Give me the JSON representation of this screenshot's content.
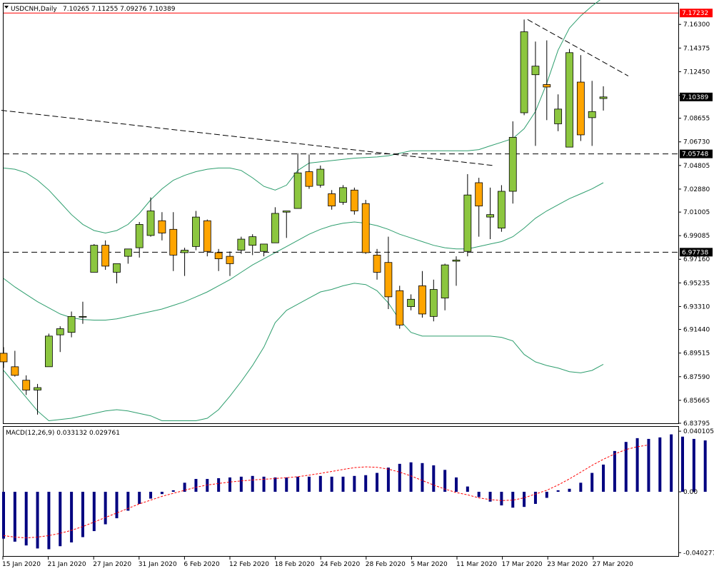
{
  "header": {
    "symbol_label": "USDCNH,Daily",
    "ohlc_label": "7.10265 7.11255 7.09276 7.10389"
  },
  "macd": {
    "label": "MACD(12,26,9) 0.033132 0.029761"
  },
  "colors": {
    "bull": "#8cc63f",
    "bear": "#ffa500",
    "candle_outline": "#000000",
    "bands": "#2e9e6e",
    "macd_hist": "#000080",
    "macd_signal": "#ff0000",
    "red_level": "#ff0000"
  },
  "chart_data": [
    {
      "type": "candlestick",
      "ylim": [
        6.83795,
        7.18
      ],
      "yticks": [
        "7.16300",
        "7.14375",
        "7.12450",
        "7.10525",
        "7.08655",
        "7.06730",
        "7.04805",
        "7.02880",
        "7.01005",
        "6.99085",
        "6.97160",
        "6.95235",
        "6.93310",
        "6.91440",
        "6.89515",
        "6.87590",
        "6.85665",
        "6.83795"
      ],
      "price_labels": [
        {
          "text": "7.17232",
          "value": 7.17232,
          "style": "red"
        },
        {
          "text": "7.10389",
          "value": 7.10389,
          "style": "box"
        },
        {
          "text": "7.05748",
          "value": 7.05748,
          "style": "box"
        },
        {
          "text": "6.97738",
          "value": 6.97738,
          "style": "box"
        }
      ],
      "x_labels": [
        "15 Jan 2020",
        "21 Jan 2020",
        "27 Jan 2020",
        "31 Jan 2020",
        "6 Feb 2020",
        "12 Feb 2020",
        "18 Feb 2020",
        "24 Feb 2020",
        "28 Feb 2020",
        "5 Mar 2020",
        "11 Mar 2020",
        "17 Mar 2020",
        "23 Mar 2020",
        "27 Mar 2020"
      ],
      "candles": [
        {
          "o": 6.895,
          "h": 6.9,
          "l": 6.883,
          "c": 6.888
        },
        {
          "o": 6.884,
          "h": 6.897,
          "l": 6.876,
          "c": 6.877
        },
        {
          "o": 6.873,
          "h": 6.877,
          "l": 6.861,
          "c": 6.865
        },
        {
          "o": 6.865,
          "h": 6.87,
          "l": 6.845,
          "c": 6.867
        },
        {
          "o": 6.884,
          "h": 6.911,
          "l": 6.884,
          "c": 6.909
        },
        {
          "o": 6.91,
          "h": 6.917,
          "l": 6.896,
          "c": 6.915
        },
        {
          "o": 6.912,
          "h": 6.929,
          "l": 6.908,
          "c": 6.925
        },
        {
          "o": 6.925,
          "h": 6.937,
          "l": 6.919,
          "c": 6.925
        },
        {
          "o": 6.961,
          "h": 6.984,
          "l": 6.961,
          "c": 6.983
        },
        {
          "o": 6.983,
          "h": 6.987,
          "l": 6.963,
          "c": 6.966
        },
        {
          "o": 6.961,
          "h": 6.968,
          "l": 6.952,
          "c": 6.968
        },
        {
          "o": 6.974,
          "h": 6.98,
          "l": 6.968,
          "c": 6.98
        },
        {
          "o": 6.981,
          "h": 7.002,
          "l": 6.973,
          "c": 7.0
        },
        {
          "o": 6.991,
          "h": 7.022,
          "l": 6.99,
          "c": 7.011
        },
        {
          "o": 7.003,
          "h": 7.01,
          "l": 6.987,
          "c": 6.993
        },
        {
          "o": 6.996,
          "h": 7.01,
          "l": 6.962,
          "c": 6.975
        },
        {
          "o": 6.977,
          "h": 6.981,
          "l": 6.958,
          "c": 6.979
        },
        {
          "o": 6.982,
          "h": 7.011,
          "l": 6.979,
          "c": 7.006
        },
        {
          "o": 7.003,
          "h": 7.004,
          "l": 6.974,
          "c": 6.978
        },
        {
          "o": 6.977,
          "h": 6.98,
          "l": 6.962,
          "c": 6.972
        },
        {
          "o": 6.974,
          "h": 6.978,
          "l": 6.958,
          "c": 6.968
        },
        {
          "o": 6.979,
          "h": 6.99,
          "l": 6.976,
          "c": 6.988
        },
        {
          "o": 6.983,
          "h": 6.992,
          "l": 6.975,
          "c": 6.99
        },
        {
          "o": 6.978,
          "h": 6.984,
          "l": 6.974,
          "c": 6.984
        },
        {
          "o": 6.985,
          "h": 7.014,
          "l": 6.985,
          "c": 7.009
        },
        {
          "o": 7.01,
          "h": 7.011,
          "l": 6.989,
          "c": 7.011
        },
        {
          "o": 7.013,
          "h": 7.058,
          "l": 7.013,
          "c": 7.042
        },
        {
          "o": 7.043,
          "h": 7.057,
          "l": 7.029,
          "c": 7.031
        },
        {
          "o": 7.032,
          "h": 7.048,
          "l": 7.03,
          "c": 7.045
        },
        {
          "o": 7.025,
          "h": 7.028,
          "l": 7.012,
          "c": 7.015
        },
        {
          "o": 7.018,
          "h": 7.032,
          "l": 7.016,
          "c": 7.03
        },
        {
          "o": 7.028,
          "h": 7.03,
          "l": 7.008,
          "c": 7.011
        },
        {
          "o": 7.017,
          "h": 7.02,
          "l": 6.976,
          "c": 6.977
        },
        {
          "o": 6.975,
          "h": 6.98,
          "l": 6.955,
          "c": 6.961
        },
        {
          "o": 6.969,
          "h": 6.99,
          "l": 6.931,
          "c": 6.941
        },
        {
          "o": 6.946,
          "h": 6.95,
          "l": 6.915,
          "c": 6.918
        },
        {
          "o": 6.933,
          "h": 6.943,
          "l": 6.93,
          "c": 6.939
        },
        {
          "o": 6.95,
          "h": 6.962,
          "l": 6.924,
          "c": 6.927
        },
        {
          "o": 6.925,
          "h": 6.955,
          "l": 6.921,
          "c": 6.947
        },
        {
          "o": 6.94,
          "h": 6.968,
          "l": 6.93,
          "c": 6.967
        },
        {
          "o": 6.97,
          "h": 6.974,
          "l": 6.95,
          "c": 6.971
        },
        {
          "o": 6.978,
          "h": 7.041,
          "l": 6.974,
          "c": 7.024
        },
        {
          "o": 7.034,
          "h": 7.038,
          "l": 6.99,
          "c": 7.015
        },
        {
          "o": 7.006,
          "h": 7.03,
          "l": 6.988,
          "c": 7.008
        },
        {
          "o": 6.997,
          "h": 7.032,
          "l": 6.994,
          "c": 7.027
        },
        {
          "o": 7.027,
          "h": 7.084,
          "l": 7.017,
          "c": 7.071
        },
        {
          "o": 7.091,
          "h": 7.167,
          "l": 7.089,
          "c": 7.157
        },
        {
          "o": 7.122,
          "h": 7.149,
          "l": 7.064,
          "c": 7.129
        },
        {
          "o": 7.114,
          "h": 7.15,
          "l": 7.085,
          "c": 7.112
        },
        {
          "o": 7.082,
          "h": 7.106,
          "l": 7.076,
          "c": 7.094
        },
        {
          "o": 7.063,
          "h": 7.143,
          "l": 7.063,
          "c": 7.14
        },
        {
          "o": 7.116,
          "h": 7.138,
          "l": 7.068,
          "c": 7.073
        },
        {
          "o": 7.087,
          "h": 7.117,
          "l": 7.064,
          "c": 7.092
        },
        {
          "o": 7.1026,
          "h": 7.1126,
          "l": 7.0928,
          "c": 7.1039
        }
      ],
      "bollinger": {
        "middle": [
          6.956,
          6.949,
          6.943,
          6.937,
          6.932,
          6.927,
          6.924,
          6.9225,
          6.922,
          6.922,
          6.923,
          6.925,
          6.927,
          6.929,
          6.931,
          6.934,
          6.937,
          6.941,
          6.945,
          6.95,
          6.955,
          6.961,
          6.967,
          6.972,
          6.977,
          6.982,
          6.987,
          6.992,
          6.996,
          6.999,
          7.001,
          7.002,
          7.001,
          6.999,
          6.996,
          6.992,
          6.989,
          6.986,
          6.983,
          6.981,
          6.98,
          6.98,
          6.982,
          6.984,
          6.986,
          6.99,
          6.997,
          7.005,
          7.011,
          7.016,
          7.021,
          7.025,
          7.029,
          7.034
        ],
        "upper": [
          7.046,
          7.045,
          7.042,
          7.036,
          7.028,
          7.018,
          7.008,
          7.0,
          6.995,
          6.993,
          6.995,
          7.0,
          7.009,
          7.02,
          7.029,
          7.036,
          7.04,
          7.043,
          7.045,
          7.046,
          7.046,
          7.044,
          7.038,
          7.031,
          7.028,
          7.032,
          7.044,
          7.05,
          7.051,
          7.052,
          7.053,
          7.054,
          7.0545,
          7.055,
          7.056,
          7.058,
          7.06,
          7.06,
          7.06,
          7.06,
          7.06,
          7.06,
          7.061,
          7.064,
          7.067,
          7.07,
          7.078,
          7.092,
          7.115,
          7.142,
          7.16,
          7.17,
          7.178,
          7.185
        ],
        "lower": [
          6.881,
          6.87,
          6.859,
          6.848,
          6.84,
          6.841,
          6.842,
          6.844,
          6.846,
          6.848,
          6.849,
          6.848,
          6.846,
          6.844,
          6.84,
          6.84,
          6.84,
          6.84,
          6.842,
          6.849,
          6.86,
          6.872,
          6.885,
          6.9,
          6.92,
          6.93,
          6.935,
          6.94,
          6.945,
          6.947,
          6.95,
          6.952,
          6.951,
          6.946,
          6.936,
          6.922,
          6.912,
          6.909,
          6.909,
          6.909,
          6.909,
          6.909,
          6.909,
          6.909,
          6.908,
          6.905,
          6.894,
          6.888,
          6.885,
          6.883,
          6.88,
          6.879,
          6.881,
          6.886
        ]
      },
      "horizontal_levels": [
        {
          "value": 7.05748,
          "style": "dashed"
        },
        {
          "value": 6.97738,
          "style": "dashed"
        },
        {
          "value": 7.17232,
          "style": "solid-red"
        }
      ],
      "trendlines": [
        {
          "from": {
            "index": -0.2,
            "value": 7.093
          },
          "to": {
            "index": 43.3,
            "value": 7.048
          }
        },
        {
          "from": {
            "index": 46.3,
            "value": 7.167
          },
          "to": {
            "index": 55.2,
            "value": 7.121
          }
        }
      ]
    },
    {
      "type": "bar",
      "ylim": [
        -0.0425,
        0.043
      ],
      "yticks": [
        "0.040105",
        "0.00",
        "-0.040277"
      ],
      "histogram": [
        -0.031,
        -0.033,
        -0.0355,
        -0.0375,
        -0.038,
        -0.036,
        -0.0335,
        -0.03,
        -0.026,
        -0.0215,
        -0.0175,
        -0.0125,
        -0.008,
        -0.0045,
        -0.0015,
        0.001,
        0.006,
        0.0085,
        0.0085,
        0.009,
        0.0095,
        0.01,
        0.0105,
        0.01,
        0.0095,
        0.0095,
        0.01,
        0.01,
        0.0105,
        0.01,
        0.01,
        0.0105,
        0.011,
        0.0125,
        0.016,
        0.0185,
        0.0195,
        0.019,
        0.0175,
        0.0145,
        0.0095,
        0.0035,
        -0.0035,
        -0.0065,
        -0.009,
        -0.0105,
        -0.01,
        -0.008,
        -0.004,
        0.001,
        0.002,
        0.006,
        0.0125,
        0.018,
        0.027,
        0.033,
        0.0355,
        0.035,
        0.036,
        0.038,
        0.0365,
        0.035,
        0.034,
        0.0335
      ],
      "signal": [
        -0.029,
        -0.03,
        -0.0305,
        -0.03,
        -0.029,
        -0.0275,
        -0.0255,
        -0.023,
        -0.02,
        -0.017,
        -0.014,
        -0.011,
        -0.008,
        -0.0055,
        -0.003,
        -0.001,
        0.001,
        0.003,
        0.0045,
        0.0055,
        0.0065,
        0.0072,
        0.0078,
        0.0083,
        0.0088,
        0.0093,
        0.01,
        0.011,
        0.0122,
        0.0135,
        0.0148,
        0.016,
        0.0165,
        0.0162,
        0.015,
        0.013,
        0.0105,
        0.0075,
        0.0045,
        0.0018,
        -0.0005,
        -0.002,
        -0.004,
        -0.0052,
        -0.0058,
        -0.0055,
        -0.004,
        -0.0015,
        0.001,
        0.0045,
        0.0085,
        0.013,
        0.0175,
        0.0215,
        0.025,
        0.028,
        0.0298,
        0.031
      ]
    }
  ]
}
